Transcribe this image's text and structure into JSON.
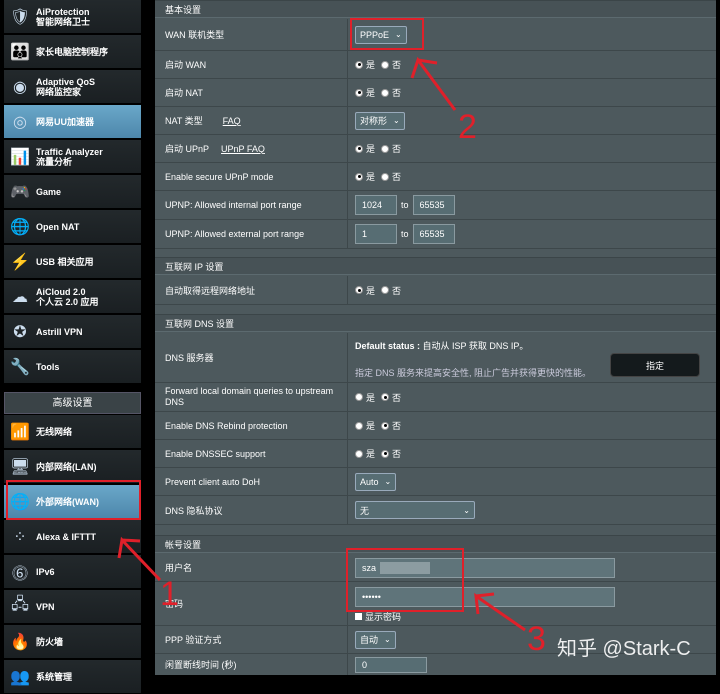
{
  "sidebar": {
    "items": [
      {
        "label": "AiProtection",
        "sub": "智能网络卫士",
        "icon": "shield-icon"
      },
      {
        "label": "家长电脑控制程序",
        "sub": "",
        "icon": "family-icon"
      },
      {
        "label": "Adaptive QoS",
        "sub": "网络监控家",
        "icon": "qos-icon"
      },
      {
        "label": "网易UU加速器",
        "sub": "",
        "icon": "uu-accelerator-icon"
      },
      {
        "label": "Traffic Analyzer",
        "sub": "流量分析",
        "icon": "traffic-icon"
      },
      {
        "label": "Game",
        "sub": "",
        "icon": "gamepad-icon"
      },
      {
        "label": "Open NAT",
        "sub": "",
        "icon": "globe-icon"
      },
      {
        "label": "USB 相关应用",
        "sub": "",
        "icon": "usb-icon"
      },
      {
        "label": "AiCloud 2.0",
        "sub": "个人云 2.0 应用",
        "icon": "cloud-icon"
      },
      {
        "label": "Astrill VPN",
        "sub": "",
        "icon": "astrill-icon"
      },
      {
        "label": "Tools",
        "sub": "",
        "icon": "wrench-icon"
      }
    ],
    "advanced_title": "高级设置",
    "adv_items": [
      {
        "label": "无线网络",
        "icon": "wifi-icon"
      },
      {
        "label": "内部网络(LAN)",
        "icon": "lan-icon"
      },
      {
        "label": "外部网络(WAN)",
        "icon": "wan-globe-icon"
      },
      {
        "label": "Alexa & IFTTT",
        "icon": "alexa-icon"
      },
      {
        "label": "IPv6",
        "icon": "ipv6-icon"
      },
      {
        "label": "VPN",
        "icon": "vpn-icon"
      },
      {
        "label": "防火墙",
        "icon": "firewall-icon"
      },
      {
        "label": "系统管理",
        "icon": "admin-icon"
      }
    ]
  },
  "basic": {
    "title": "基本设置",
    "wan_type_label": "WAN 联机类型",
    "wan_type_value": "PPPoE",
    "enable_wan_label": "启动 WAN",
    "enable_nat_label": "启动 NAT",
    "nat_type_label": "NAT 类型",
    "nat_type_faq": "FAQ",
    "nat_type_value": "对称形",
    "upnp_label": "启动 UPnP",
    "upnp_faq": "UPnP  FAQ",
    "secure_upnp_label": "Enable secure UPnP mode",
    "upnp_int_label": "UPNP: Allowed internal port range",
    "upnp_int_from": "1024",
    "upnp_int_to": "65535",
    "upnp_ext_label": "UPNP: Allowed external port range",
    "upnp_ext_from": "1",
    "upnp_ext_to": "65535",
    "yes": "是",
    "no": "否",
    "to": "to"
  },
  "ip": {
    "title": "互联网 IP 设置",
    "auto_label": "自动取得远程网络地址"
  },
  "dns": {
    "title": "互联网 DNS 设置",
    "server_label": "DNS 服务器",
    "default_status_label": "Default status :",
    "default_status_value": "自动从 ISP 获取 DNS IP。",
    "note": "指定 DNS 服务来提高安全性, 阻止广告并获得更快的性能。",
    "assign_button": "指定",
    "forward_label": "Forward local domain queries to upstream DNS",
    "rebind_label": "Enable DNS Rebind protection",
    "dnssec_label": "Enable DNSSEC support",
    "doh_label": "Prevent client auto DoH",
    "doh_value": "Auto",
    "privacy_label": "DNS 隐私协议",
    "privacy_value": "无"
  },
  "account": {
    "title": "帐号设置",
    "user_label": "用户名",
    "user_value": "sza",
    "pass_label": "密码",
    "pass_value": "••••••",
    "show_pass": "显示密码",
    "auth_label": "PPP 验证方式",
    "auth_value": "自动",
    "idle_label": "闲置断线时间 (秒)",
    "idle_value": "0"
  },
  "annotations": {
    "n1": "1",
    "n2": "2",
    "n3": "3"
  },
  "watermark": "知乎 @Stark-C",
  "colors": {
    "annotation_red": "#e0202a",
    "active_blue": "#5a97bb",
    "panel": "#4d595d"
  }
}
